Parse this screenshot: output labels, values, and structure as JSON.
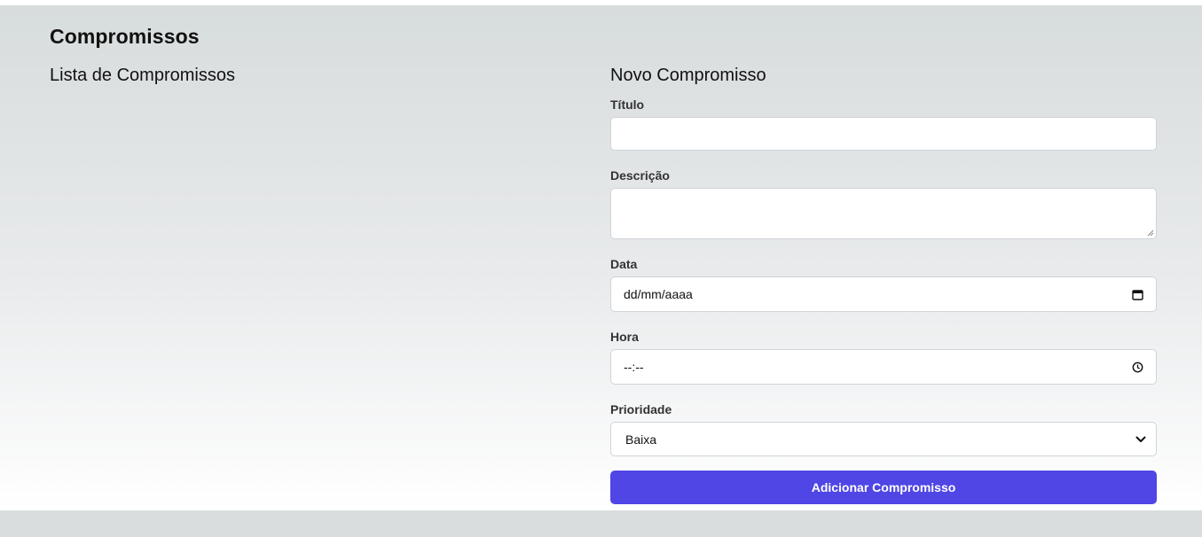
{
  "page": {
    "title": "Compromissos"
  },
  "list": {
    "title": "Lista de Compromissos"
  },
  "form": {
    "title": "Novo Compromisso",
    "fields": {
      "titulo": {
        "label": "Título",
        "value": ""
      },
      "descricao": {
        "label": "Descrição",
        "value": ""
      },
      "data": {
        "label": "Data",
        "value": "dd/mm/aaaa",
        "icon": "calendar-icon"
      },
      "hora": {
        "label": "Hora",
        "value": "--:--",
        "icon": "clock-icon"
      },
      "prioridade": {
        "label": "Prioridade",
        "value": "Baixa",
        "icon": "chevron-down-icon"
      }
    },
    "submit_label": "Adicionar Compromisso"
  },
  "colors": {
    "accent": "#4f46e5",
    "background": "#d9dddd"
  }
}
